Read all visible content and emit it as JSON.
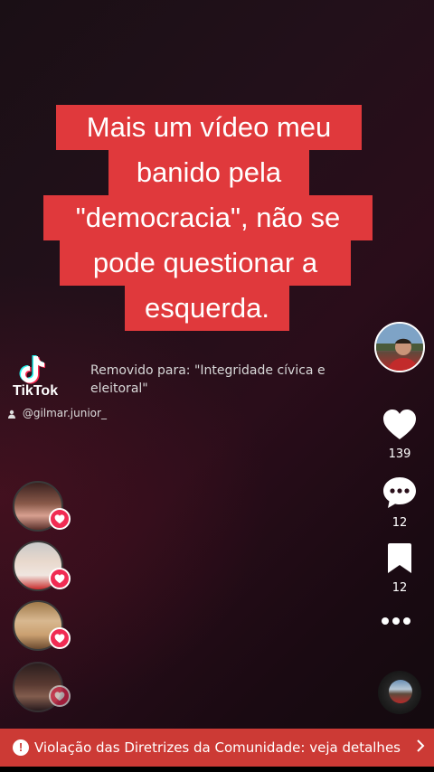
{
  "caption": {
    "lines": [
      "Mais um vídeo meu",
      "banido pela",
      "\"democracia\", não se",
      "pode questionar a",
      "esquerda."
    ],
    "background_color": "#e0393c"
  },
  "removed_notice": {
    "line1": "Removido para: \"Integridade cívica e",
    "line2": "eleitoral\""
  },
  "watermark": {
    "brand": "TikTok",
    "username": "@gilmar.junior_"
  },
  "rail": {
    "likes": "139",
    "comments": "12",
    "saves": "12",
    "icons": [
      "heart-icon",
      "comment-icon",
      "bookmark-icon",
      "more-icon"
    ]
  },
  "violation_bar": {
    "text": "Violação das Diretrizes da Comunidade: veja detalhes",
    "warn_glyph": "!",
    "color": "#cc3a35"
  }
}
